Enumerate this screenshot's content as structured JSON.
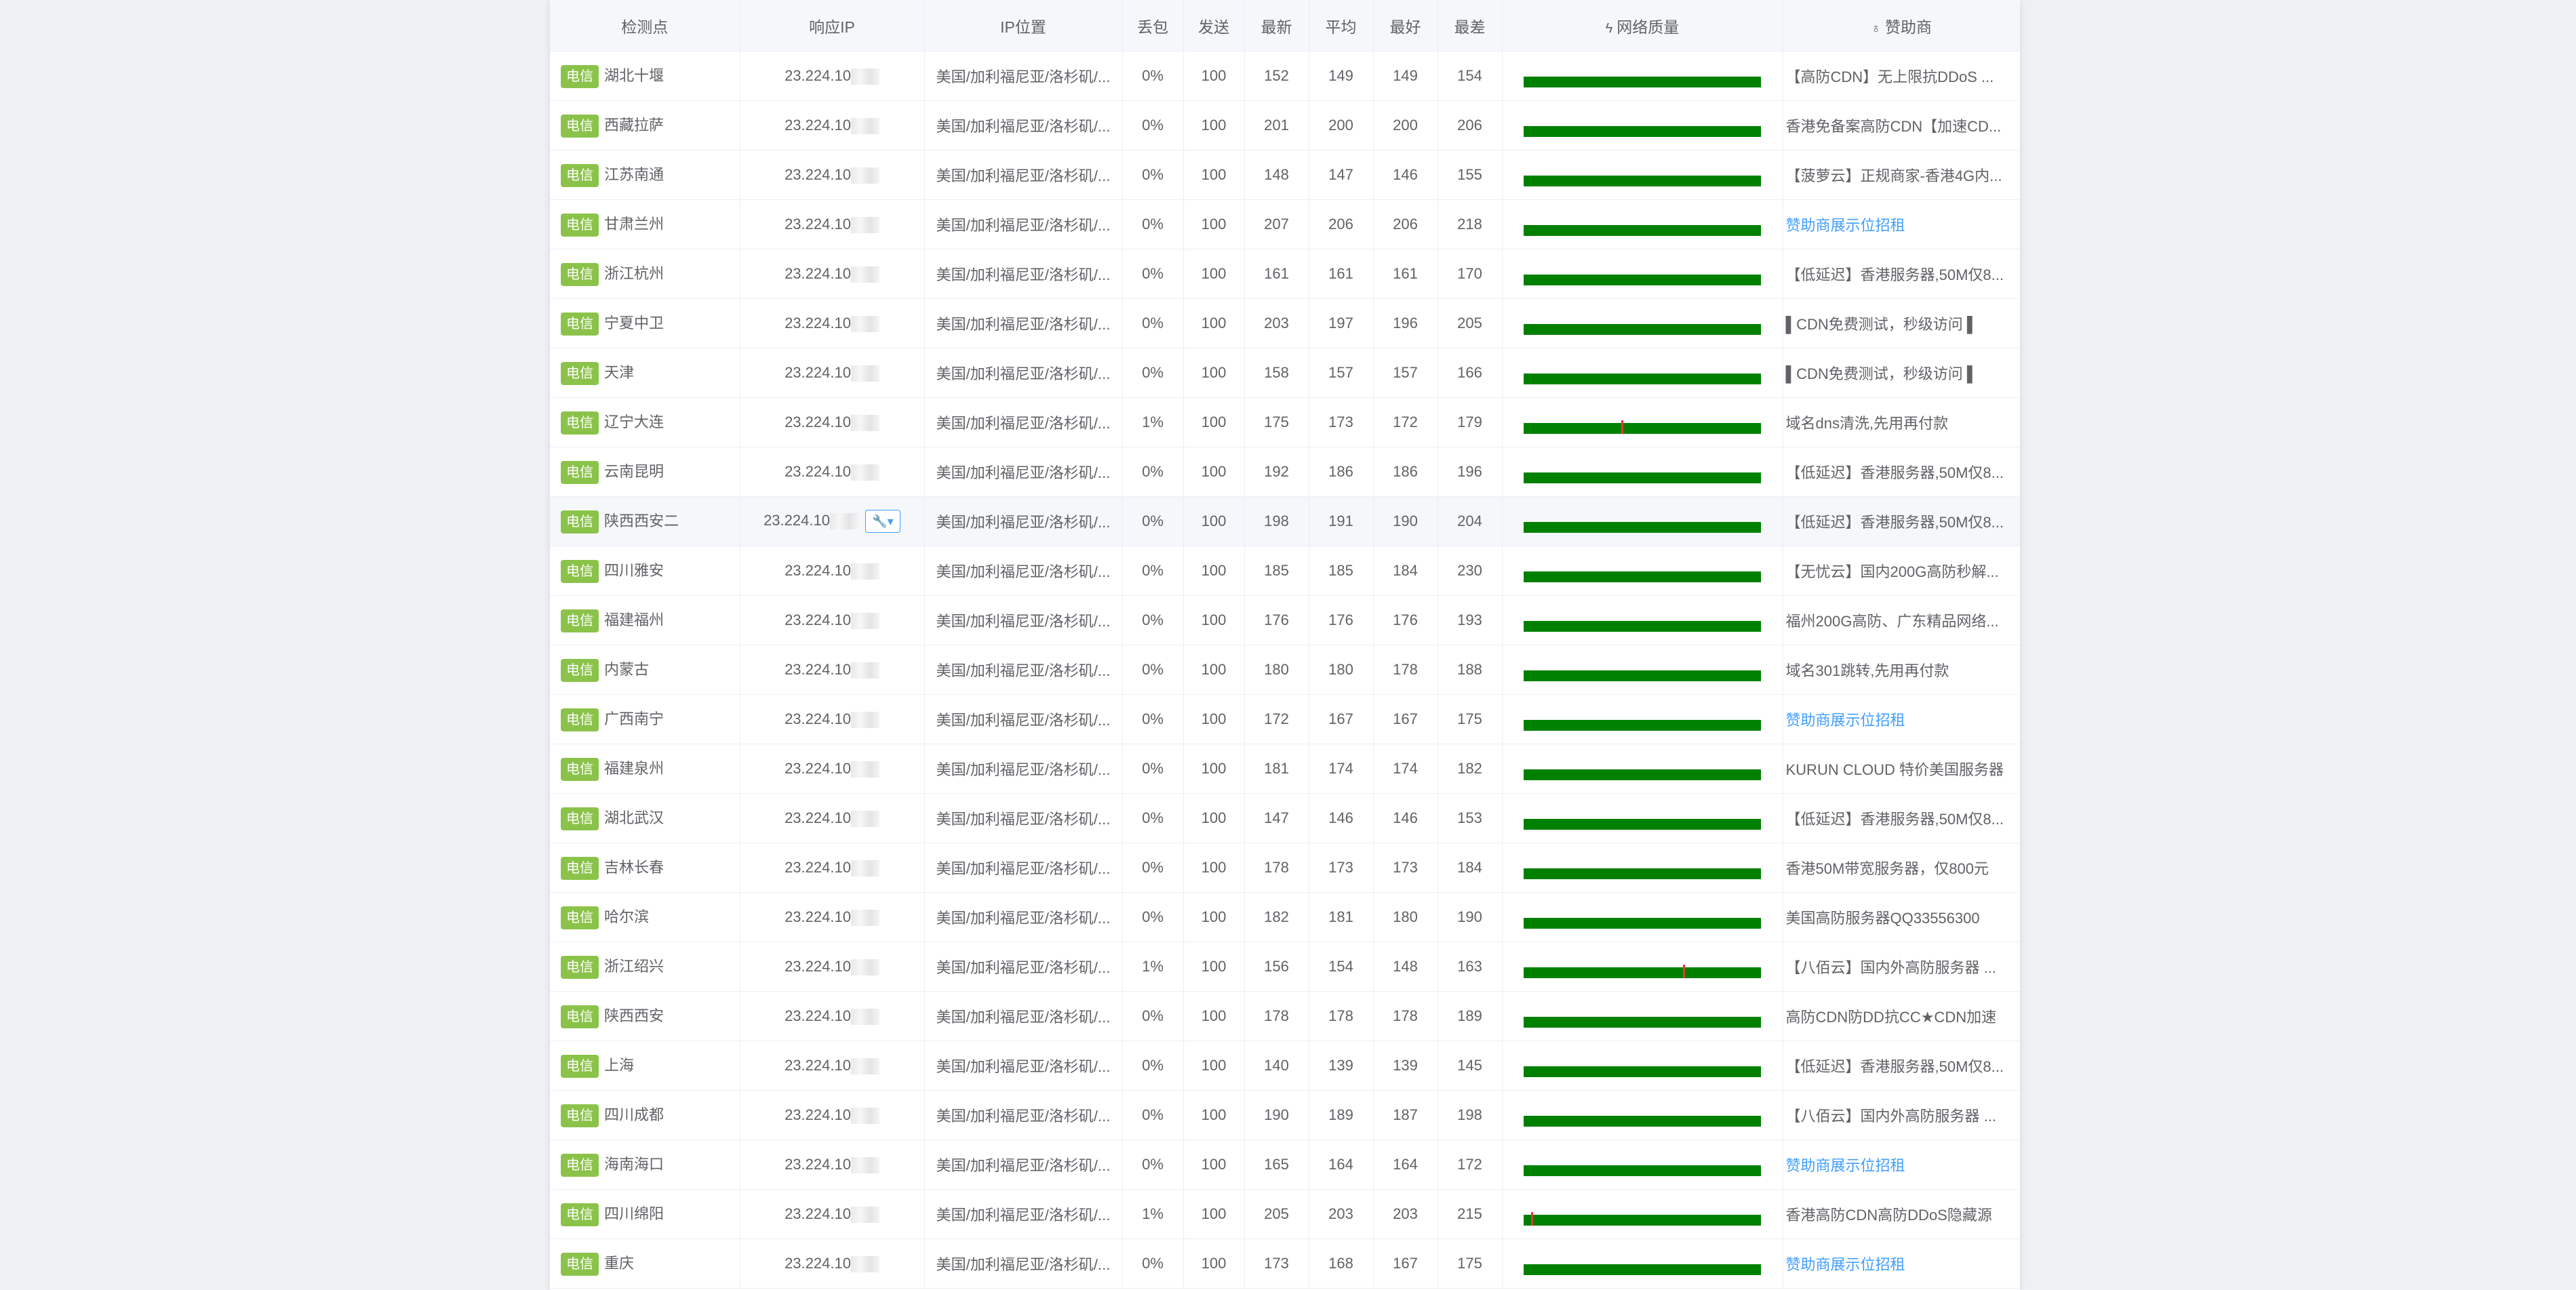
{
  "headers": {
    "node": "检测点",
    "ip": "响应IP",
    "location": "IP位置",
    "loss": "丢包",
    "sent": "发送",
    "latest": "最新",
    "avg": "平均",
    "best": "最好",
    "worst": "最差",
    "quality": "网络质量",
    "sponsor": "赞助商"
  },
  "icons": {
    "quality": "pulse-icon",
    "sponsor": "medal-icon",
    "tool": "wrench-dropdown-icon"
  },
  "colors": {
    "isp_tag": "#8bc34a",
    "quality_bar": "#008000",
    "loss_mark": "#e53935",
    "sponsor_link": "#409eff"
  },
  "rows": [
    {
      "isp": "电信",
      "node": "湖北十堰",
      "ip": "23.224.10",
      "location": "美国/加利福尼亚/洛杉矶/...",
      "loss": "0%",
      "sent": "100",
      "latest": "152",
      "avg": "149",
      "best": "149",
      "worst": "154",
      "quality_loss_marks": [],
      "sponsor": "【高防CDN】无上限抗DDoS ...",
      "sponsor_link": false
    },
    {
      "isp": "电信",
      "node": "西藏拉萨",
      "ip": "23.224.10",
      "location": "美国/加利福尼亚/洛杉矶/...",
      "loss": "0%",
      "sent": "100",
      "latest": "201",
      "avg": "200",
      "best": "200",
      "worst": "206",
      "quality_loss_marks": [],
      "sponsor": "香港免备案高防CDN【加速CD...",
      "sponsor_link": false
    },
    {
      "isp": "电信",
      "node": "江苏南通",
      "ip": "23.224.10",
      "location": "美国/加利福尼亚/洛杉矶/...",
      "loss": "0%",
      "sent": "100",
      "latest": "148",
      "avg": "147",
      "best": "146",
      "worst": "155",
      "quality_loss_marks": [],
      "sponsor": "【菠萝云】正规商家-香港4G内...",
      "sponsor_link": false
    },
    {
      "isp": "电信",
      "node": "甘肃兰州",
      "ip": "23.224.10",
      "location": "美国/加利福尼亚/洛杉矶/...",
      "loss": "0%",
      "sent": "100",
      "latest": "207",
      "avg": "206",
      "best": "206",
      "worst": "218",
      "quality_loss_marks": [],
      "sponsor": "赞助商展示位招租",
      "sponsor_link": true
    },
    {
      "isp": "电信",
      "node": "浙江杭州",
      "ip": "23.224.10",
      "location": "美国/加利福尼亚/洛杉矶/...",
      "loss": "0%",
      "sent": "100",
      "latest": "161",
      "avg": "161",
      "best": "161",
      "worst": "170",
      "quality_loss_marks": [],
      "sponsor": "【低延迟】香港服务器,50M仅8...",
      "sponsor_link": false
    },
    {
      "isp": "电信",
      "node": "宁夏中卫",
      "ip": "23.224.10",
      "location": "美国/加利福尼亚/洛杉矶/...",
      "loss": "0%",
      "sent": "100",
      "latest": "203",
      "avg": "197",
      "best": "196",
      "worst": "205",
      "quality_loss_marks": [],
      "sponsor": "▌CDN免费测试，秒级访问 ▌",
      "sponsor_link": false
    },
    {
      "isp": "电信",
      "node": "天津",
      "ip": "23.224.10",
      "location": "美国/加利福尼亚/洛杉矶/...",
      "loss": "0%",
      "sent": "100",
      "latest": "158",
      "avg": "157",
      "best": "157",
      "worst": "166",
      "quality_loss_marks": [],
      "sponsor": "▌CDN免费测试，秒级访问 ▌",
      "sponsor_link": false
    },
    {
      "isp": "电信",
      "node": "辽宁大连",
      "ip": "23.224.10",
      "location": "美国/加利福尼亚/洛杉矶/...",
      "loss": "1%",
      "sent": "100",
      "latest": "175",
      "avg": "173",
      "best": "172",
      "worst": "179",
      "quality_loss_marks": [
        0.41
      ],
      "sponsor": "域名dns清洗,先用再付款",
      "sponsor_link": false
    },
    {
      "isp": "电信",
      "node": "云南昆明",
      "ip": "23.224.10",
      "location": "美国/加利福尼亚/洛杉矶/...",
      "loss": "0%",
      "sent": "100",
      "latest": "192",
      "avg": "186",
      "best": "186",
      "worst": "196",
      "quality_loss_marks": [],
      "sponsor": "【低延迟】香港服务器,50M仅8...",
      "sponsor_link": false
    },
    {
      "isp": "电信",
      "node": "陕西西安二",
      "ip": "23.224.10",
      "location": "美国/加利福尼亚/洛杉矶/...",
      "loss": "0%",
      "sent": "100",
      "latest": "198",
      "avg": "191",
      "best": "190",
      "worst": "204",
      "quality_loss_marks": [],
      "sponsor": "【低延迟】香港服务器,50M仅8...",
      "sponsor_link": false,
      "highlight": true,
      "has_tool": true
    },
    {
      "isp": "电信",
      "node": "四川雅安",
      "ip": "23.224.10",
      "location": "美国/加利福尼亚/洛杉矶/...",
      "loss": "0%",
      "sent": "100",
      "latest": "185",
      "avg": "185",
      "best": "184",
      "worst": "230",
      "quality_loss_marks": [],
      "sponsor": "【无忧云】国内200G高防秒解...",
      "sponsor_link": false
    },
    {
      "isp": "电信",
      "node": "福建福州",
      "ip": "23.224.10",
      "location": "美国/加利福尼亚/洛杉矶/...",
      "loss": "0%",
      "sent": "100",
      "latest": "176",
      "avg": "176",
      "best": "176",
      "worst": "193",
      "quality_loss_marks": [],
      "sponsor": "福州200G高防、广东精品网络...",
      "sponsor_link": false
    },
    {
      "isp": "电信",
      "node": "内蒙古",
      "ip": "23.224.10",
      "location": "美国/加利福尼亚/洛杉矶/...",
      "loss": "0%",
      "sent": "100",
      "latest": "180",
      "avg": "180",
      "best": "178",
      "worst": "188",
      "quality_loss_marks": [],
      "sponsor": "域名301跳转,先用再付款",
      "sponsor_link": false
    },
    {
      "isp": "电信",
      "node": "广西南宁",
      "ip": "23.224.10",
      "location": "美国/加利福尼亚/洛杉矶/...",
      "loss": "0%",
      "sent": "100",
      "latest": "172",
      "avg": "167",
      "best": "167",
      "worst": "175",
      "quality_loss_marks": [],
      "sponsor": "赞助商展示位招租",
      "sponsor_link": true
    },
    {
      "isp": "电信",
      "node": "福建泉州",
      "ip": "23.224.10",
      "location": "美国/加利福尼亚/洛杉矶/...",
      "loss": "0%",
      "sent": "100",
      "latest": "181",
      "avg": "174",
      "best": "174",
      "worst": "182",
      "quality_loss_marks": [],
      "sponsor": "KURUN CLOUD 特价美国服务器",
      "sponsor_link": false
    },
    {
      "isp": "电信",
      "node": "湖北武汉",
      "ip": "23.224.10",
      "location": "美国/加利福尼亚/洛杉矶/...",
      "loss": "0%",
      "sent": "100",
      "latest": "147",
      "avg": "146",
      "best": "146",
      "worst": "153",
      "quality_loss_marks": [],
      "sponsor": "【低延迟】香港服务器,50M仅8...",
      "sponsor_link": false
    },
    {
      "isp": "电信",
      "node": "吉林长春",
      "ip": "23.224.10",
      "location": "美国/加利福尼亚/洛杉矶/...",
      "loss": "0%",
      "sent": "100",
      "latest": "178",
      "avg": "173",
      "best": "173",
      "worst": "184",
      "quality_loss_marks": [],
      "sponsor": "香港50M带宽服务器，仅800元",
      "sponsor_link": false
    },
    {
      "isp": "电信",
      "node": "哈尔滨",
      "ip": "23.224.10",
      "location": "美国/加利福尼亚/洛杉矶/...",
      "loss": "0%",
      "sent": "100",
      "latest": "182",
      "avg": "181",
      "best": "180",
      "worst": "190",
      "quality_loss_marks": [],
      "sponsor": "美国高防服务器QQ33556300",
      "sponsor_link": false
    },
    {
      "isp": "电信",
      "node": "浙江绍兴",
      "ip": "23.224.10",
      "location": "美国/加利福尼亚/洛杉矶/...",
      "loss": "1%",
      "sent": "100",
      "latest": "156",
      "avg": "154",
      "best": "148",
      "worst": "163",
      "quality_loss_marks": [
        0.67
      ],
      "sponsor": "【八佰云】国内外高防服务器 ...",
      "sponsor_link": false
    },
    {
      "isp": "电信",
      "node": "陕西西安",
      "ip": "23.224.10",
      "location": "美国/加利福尼亚/洛杉矶/...",
      "loss": "0%",
      "sent": "100",
      "latest": "178",
      "avg": "178",
      "best": "178",
      "worst": "189",
      "quality_loss_marks": [],
      "sponsor": "高防CDN防DD抗CC★CDN加速",
      "sponsor_link": false
    },
    {
      "isp": "电信",
      "node": "上海",
      "ip": "23.224.10",
      "location": "美国/加利福尼亚/洛杉矶/...",
      "loss": "0%",
      "sent": "100",
      "latest": "140",
      "avg": "139",
      "best": "139",
      "worst": "145",
      "quality_loss_marks": [],
      "sponsor": "【低延迟】香港服务器,50M仅8...",
      "sponsor_link": false
    },
    {
      "isp": "电信",
      "node": "四川成都",
      "ip": "23.224.10",
      "location": "美国/加利福尼亚/洛杉矶/...",
      "loss": "0%",
      "sent": "100",
      "latest": "190",
      "avg": "189",
      "best": "187",
      "worst": "198",
      "quality_loss_marks": [],
      "sponsor": "【八佰云】国内外高防服务器 ...",
      "sponsor_link": false
    },
    {
      "isp": "电信",
      "node": "海南海口",
      "ip": "23.224.10",
      "location": "美国/加利福尼亚/洛杉矶/...",
      "loss": "0%",
      "sent": "100",
      "latest": "165",
      "avg": "164",
      "best": "164",
      "worst": "172",
      "quality_loss_marks": [],
      "sponsor": "赞助商展示位招租",
      "sponsor_link": true
    },
    {
      "isp": "电信",
      "node": "四川绵阳",
      "ip": "23.224.10",
      "location": "美国/加利福尼亚/洛杉矶/...",
      "loss": "1%",
      "sent": "100",
      "latest": "205",
      "avg": "203",
      "best": "203",
      "worst": "215",
      "quality_loss_marks": [
        0.03
      ],
      "sponsor": "香港高防CDN高防DDoS隐藏源",
      "sponsor_link": false
    },
    {
      "isp": "电信",
      "node": "重庆",
      "ip": "23.224.10",
      "location": "美国/加利福尼亚/洛杉矶/...",
      "loss": "0%",
      "sent": "100",
      "latest": "173",
      "avg": "168",
      "best": "167",
      "worst": "175",
      "quality_loss_marks": [],
      "sponsor": "赞助商展示位招租",
      "sponsor_link": true
    }
  ]
}
